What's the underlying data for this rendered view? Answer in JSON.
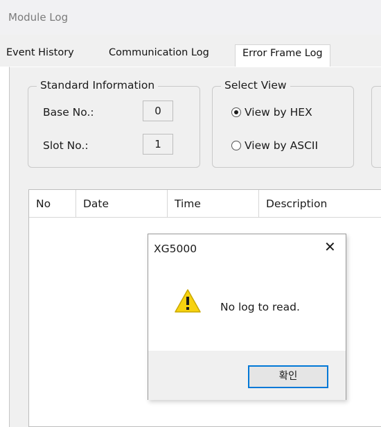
{
  "window": {
    "title": "Module Log"
  },
  "tabs": [
    {
      "label": "Event History"
    },
    {
      "label": "Communication Log"
    },
    {
      "label": "Error Frame Log",
      "active": true
    }
  ],
  "standard_info": {
    "legend": "Standard Information",
    "base_label": "Base No.:",
    "base_value": "0",
    "slot_label": "Slot No.:",
    "slot_value": "1"
  },
  "select_view": {
    "legend": "Select View",
    "options": [
      {
        "label": "View by HEX",
        "checked": true
      },
      {
        "label": "View by ASCII",
        "checked": false
      }
    ]
  },
  "table": {
    "columns": [
      "No",
      "Date",
      "Time",
      "Description"
    ],
    "rows": []
  },
  "dialog": {
    "title": "XG5000",
    "close_glyph": "✕",
    "icon": "warning-icon",
    "message": "No log to read.",
    "ok_label": "확인"
  },
  "colors": {
    "titlebar_bg": "#f1f1f3",
    "panel_bg": "#f0f0f0",
    "warning_fill": "#f7d20f",
    "focus_border": "#0078d7"
  }
}
